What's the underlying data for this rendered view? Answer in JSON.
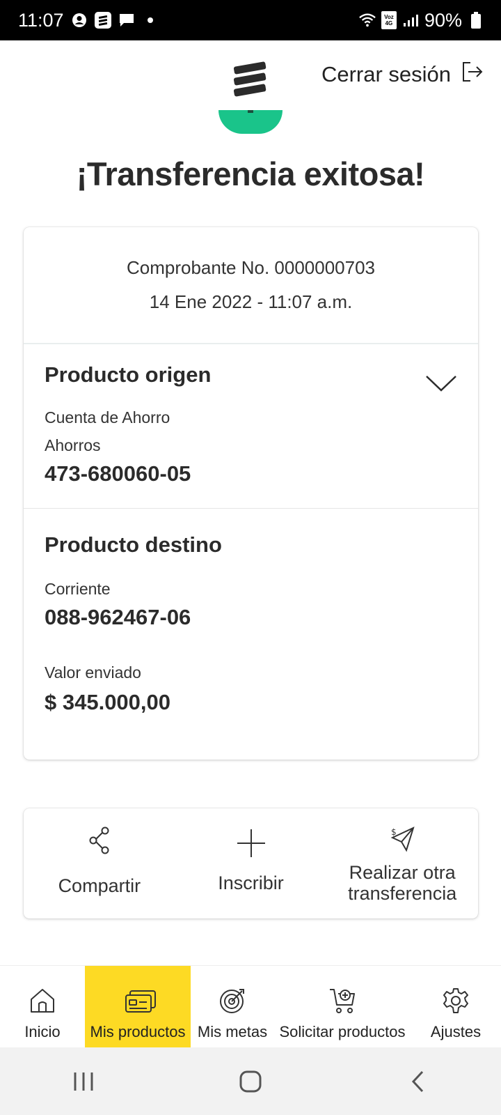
{
  "status_bar": {
    "time": "11:07",
    "network": "Voz 4G",
    "battery": "90%"
  },
  "header": {
    "logout_label": "Cerrar sesión"
  },
  "title": "¡Transferencia exitosa!",
  "receipt": {
    "voucher": "Comprobante No. 0000000703",
    "datetime": "14 Ene 2022 - 11:07 a.m.",
    "origin": {
      "title": "Producto origen",
      "type": "Cuenta de Ahorro",
      "subtype": "Ahorros",
      "number": "473-680060-05"
    },
    "destination": {
      "title": "Producto destino",
      "type": "Corriente",
      "number": "088-962467-06"
    },
    "amount_label": "Valor enviado",
    "amount": "$ 345.000,00"
  },
  "actions": [
    {
      "label": "Compartir",
      "icon": "share-icon"
    },
    {
      "label": "Inscribir",
      "icon": "plus-icon"
    },
    {
      "label_line1": "Realizar otra",
      "label_line2": "transferencia",
      "icon": "send-money-icon"
    }
  ],
  "bottom_nav": [
    {
      "label": "Inicio",
      "icon": "home-icon"
    },
    {
      "label": "Mis productos",
      "icon": "cards-icon",
      "active": true
    },
    {
      "label": "Mis metas",
      "icon": "target-icon"
    },
    {
      "label": "Solicitar productos",
      "icon": "cart-plus-icon"
    },
    {
      "label": "Ajustes",
      "icon": "gear-icon"
    }
  ],
  "colors": {
    "accent_yellow": "#fdda24",
    "success_green": "#1ac48a",
    "text_dark": "#2b2b2b"
  }
}
